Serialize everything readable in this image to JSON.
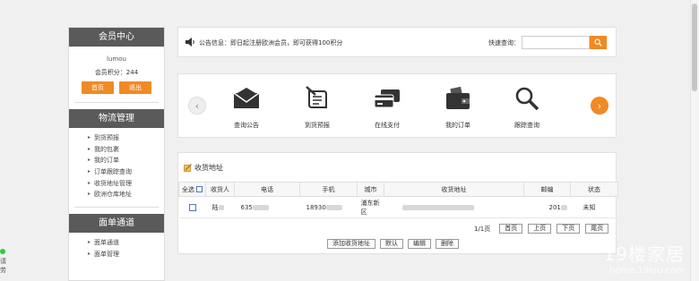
{
  "sidebar": {
    "member_center_title": "会员中心",
    "username": "lumou",
    "points": "会员积分：244",
    "home_button": "首页",
    "logout_button": "退出",
    "logistics_title": "物流管理",
    "logistics_items": [
      "到货预报",
      "我的包裹",
      "我的订单",
      "订单跟踪查询",
      "收货地址管理",
      "欧洲仓库地址"
    ],
    "waybill_title": "面单通道",
    "waybill_items": [
      "面单通道",
      "面单管理"
    ]
  },
  "notice": {
    "text": "公告信息：即日起注册欧洲会员，即可获得100积分",
    "quick_query_label": "快速查询："
  },
  "services": [
    "查询公告",
    "到货预报",
    "在线支付",
    "我的订单",
    "跟踪查询"
  ],
  "address": {
    "title": "收货地址",
    "headers": [
      "全选",
      "收货人",
      "电话",
      "手机",
      "城市",
      "收货地址",
      "邮编",
      "状态"
    ],
    "row": {
      "name": "陆",
      "phone": "635",
      "mobile": "18930",
      "city": "浦东新区",
      "zip": "201",
      "status": "未知"
    },
    "page_info": "1/1页",
    "pager": [
      "首页",
      "上页",
      "下页",
      "尾页"
    ],
    "actions": [
      "添加收货地址",
      "默认",
      "编辑",
      "删除"
    ]
  },
  "watermark": {
    "line1": "19楼家居",
    "line2": "home.19lou.com"
  },
  "left_fragment": "请\n劳",
  "colors": {
    "accent": "#f08a24",
    "header_dark": "#5a5a5a"
  }
}
